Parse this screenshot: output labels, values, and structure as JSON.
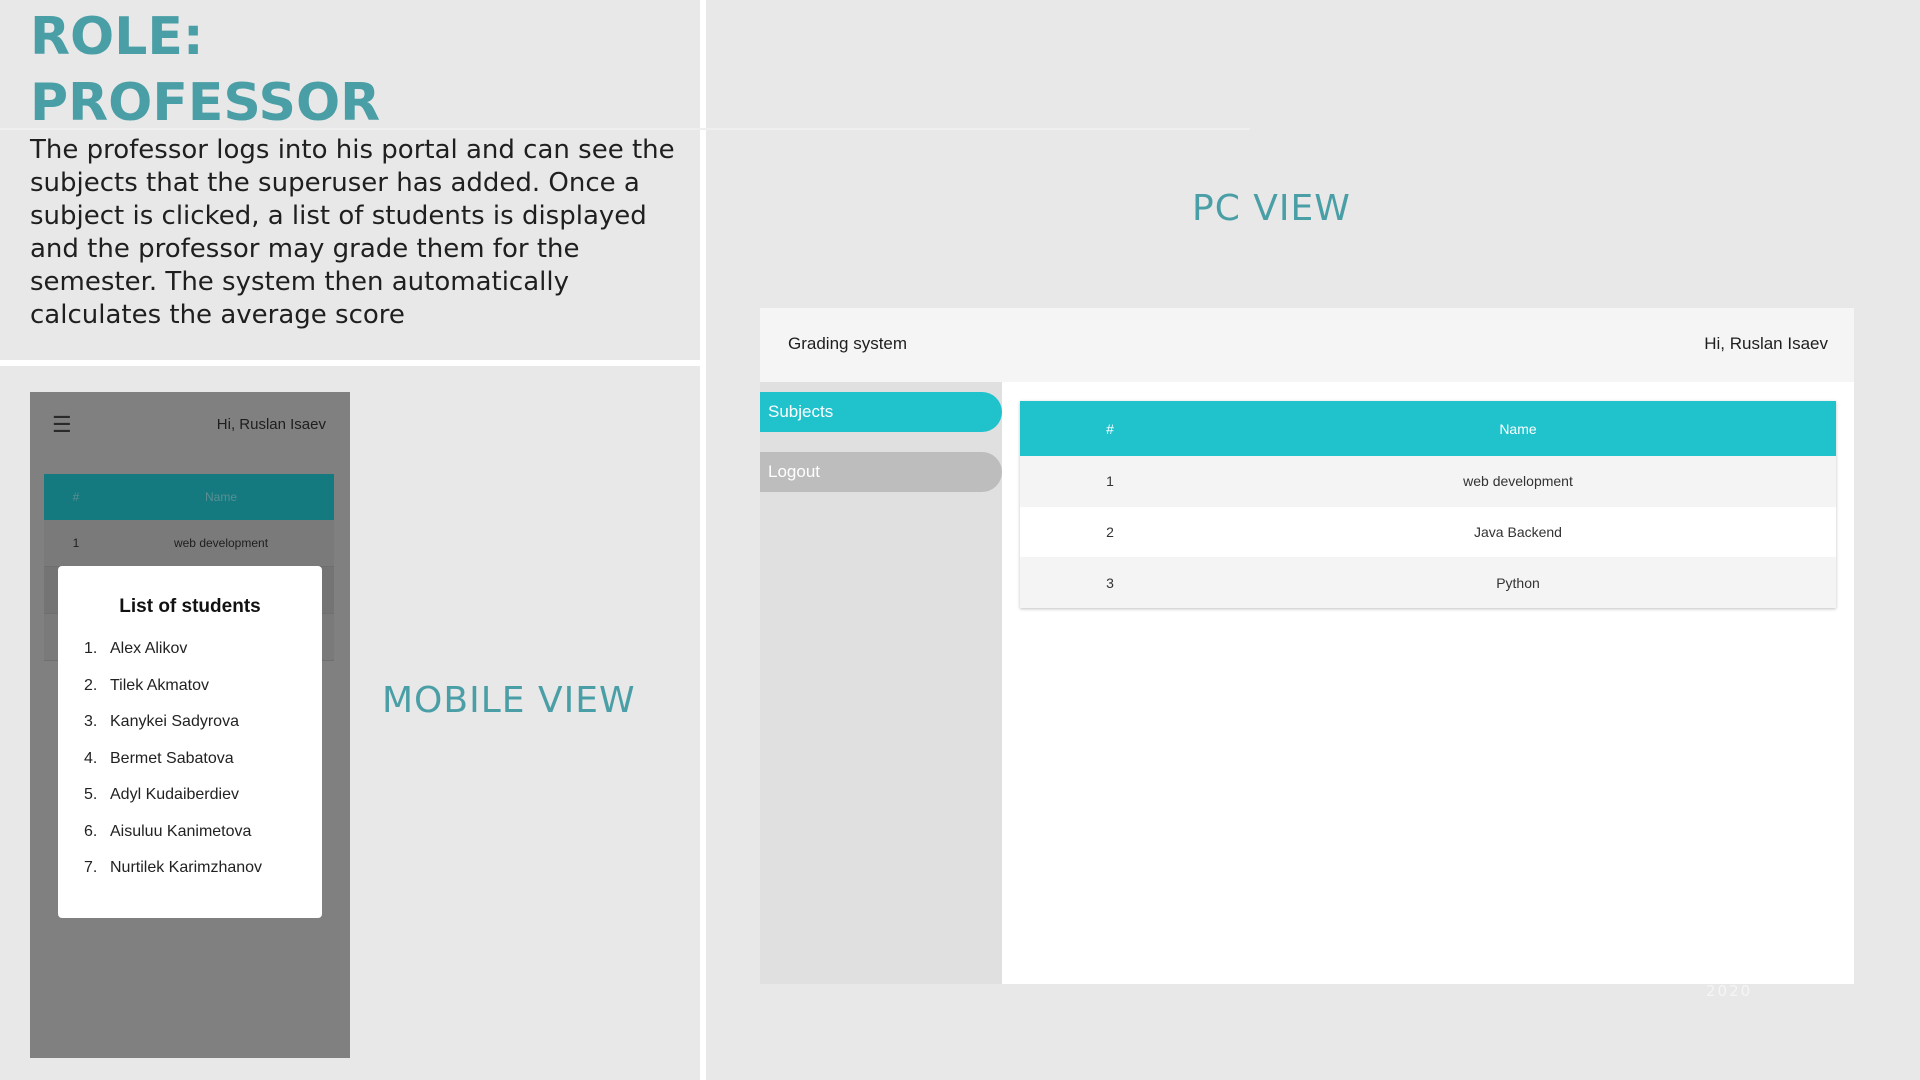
{
  "slide": {
    "title_line1": "ROLE:",
    "title_line2": "PROFESSOR",
    "description": "The professor logs into his portal and can see the subjects that the superuser has added. Once a subject is clicked, a list of students is displayed and the professor may grade them for the semester. The system then automatically calculates the average score",
    "pc_view_label": "PC VIEW",
    "mobile_view_label": "MOBILE VIEW",
    "year": "2020",
    "accent_color": "#4a9fa6"
  },
  "mobile": {
    "menu_icon": "hamburger-menu-icon",
    "menu_glyph": "☰",
    "greeting": "Hi, Ruslan Isaev",
    "table": {
      "headers": [
        "#",
        "Name"
      ],
      "rows": [
        {
          "num": "1",
          "name": "web development"
        }
      ]
    },
    "modal": {
      "title": "List of students",
      "students": [
        {
          "num": "1.",
          "name": "Alex Alikov"
        },
        {
          "num": "2.",
          "name": "Tilek Akmatov"
        },
        {
          "num": "3.",
          "name": "Kanykei Sadyrova"
        },
        {
          "num": "4.",
          "name": "Bermet Sabatova"
        },
        {
          "num": "5.",
          "name": "Adyl Kudaiberdiev"
        },
        {
          "num": "6.",
          "name": "Aisuluu Kanimetova"
        },
        {
          "num": "7.",
          "name": "Nurtilek Karimzhanov"
        }
      ]
    }
  },
  "pc": {
    "app_title": "Grading system",
    "greeting": "Hi, Ruslan Isaev",
    "nav": [
      {
        "label": "Subjects",
        "active": true
      },
      {
        "label": "Logout",
        "active": false
      }
    ],
    "table": {
      "headers": [
        "#",
        "Name"
      ],
      "rows": [
        {
          "num": "1",
          "name": "web development"
        },
        {
          "num": "2",
          "name": "Java Backend"
        },
        {
          "num": "3",
          "name": "Python"
        }
      ]
    },
    "colors": {
      "header": "#20c2cc",
      "sidebar": "#e0e0e0",
      "logout": "#bdbdbd"
    }
  }
}
